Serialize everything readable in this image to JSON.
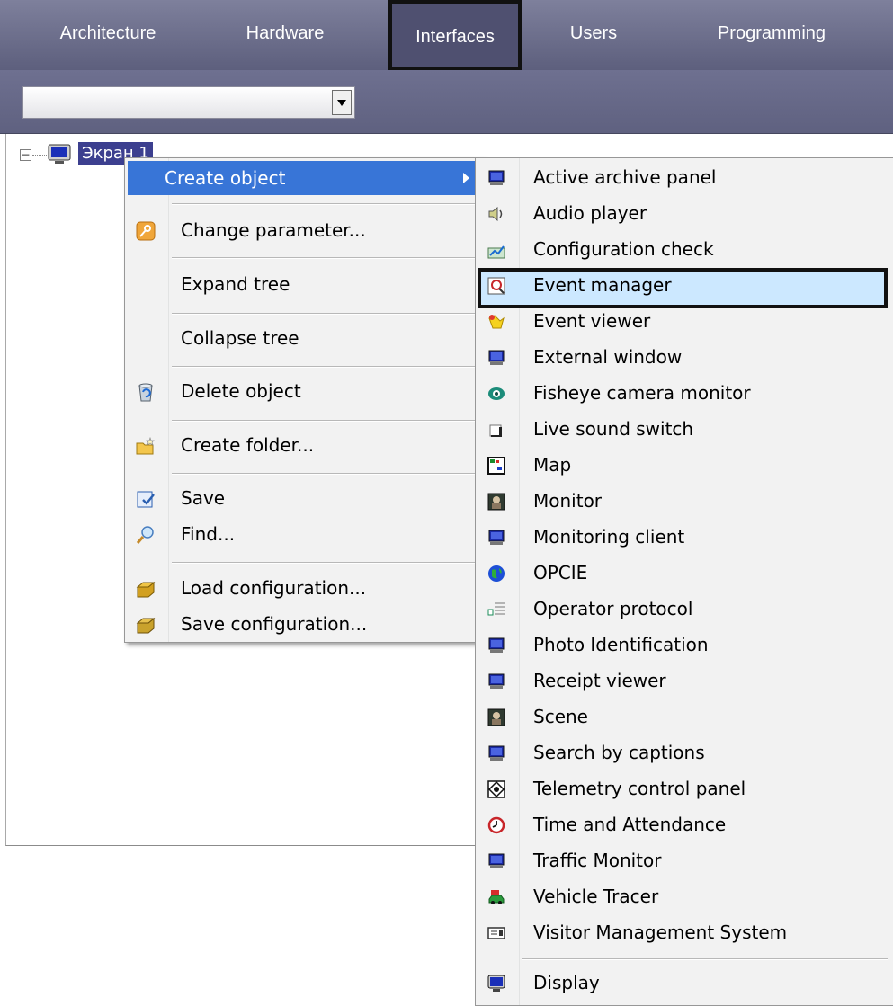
{
  "tabs": [
    {
      "label": "Architecture",
      "active": false
    },
    {
      "label": "Hardware",
      "active": false
    },
    {
      "label": "Interfaces",
      "active": true
    },
    {
      "label": "Users",
      "active": false
    },
    {
      "label": "Programming",
      "active": false
    }
  ],
  "dropdown": {
    "value": ""
  },
  "tree": {
    "root_label": "Экран 1"
  },
  "context_menu": {
    "items": [
      {
        "label": "Create object",
        "icon": "none",
        "has_submenu": true,
        "highlighted": true
      },
      {
        "label": "Change parameter...",
        "icon": "key-icon"
      },
      {
        "label": "Expand tree",
        "icon": "none"
      },
      {
        "label": "Collapse tree",
        "icon": "none"
      },
      {
        "label": "Delete object",
        "icon": "recycle-bin-icon"
      },
      {
        "label": "Create folder...",
        "icon": "new-folder-icon"
      },
      {
        "label": "Save",
        "icon": "save-icon"
      },
      {
        "label": "Find...",
        "icon": "magnifier-icon"
      },
      {
        "label": "Load configuration...",
        "icon": "load-config-icon"
      },
      {
        "label": "Save configuration...",
        "icon": "save-config-icon"
      }
    ]
  },
  "submenu": {
    "items": [
      {
        "label": "Active archive panel",
        "icon": "monitor-icon"
      },
      {
        "label": "Audio player",
        "icon": "speaker-icon"
      },
      {
        "label": "Configuration check",
        "icon": "chart-check-icon"
      },
      {
        "label": "Event manager",
        "icon": "event-manager-icon",
        "highlighted": true
      },
      {
        "label": "Event viewer",
        "icon": "event-viewer-icon"
      },
      {
        "label": "External window",
        "icon": "monitor-icon"
      },
      {
        "label": "Fisheye camera monitor",
        "icon": "fisheye-icon"
      },
      {
        "label": "Live sound switch",
        "icon": "window-icon"
      },
      {
        "label": "Map",
        "icon": "map-icon"
      },
      {
        "label": "Monitor",
        "icon": "camera-monitor-icon"
      },
      {
        "label": "Monitoring client",
        "icon": "monitor-icon"
      },
      {
        "label": "OPCIE",
        "icon": "globe-icon"
      },
      {
        "label": "Operator protocol",
        "icon": "protocol-list-icon"
      },
      {
        "label": "Photo Identification",
        "icon": "monitor-icon"
      },
      {
        "label": "Receipt viewer",
        "icon": "monitor-icon"
      },
      {
        "label": "Scene",
        "icon": "camera-monitor-icon"
      },
      {
        "label": "Search by captions",
        "icon": "monitor-icon"
      },
      {
        "label": "Telemetry control panel",
        "icon": "telemetry-icon"
      },
      {
        "label": "Time and Attendance",
        "icon": "clock-icon"
      },
      {
        "label": "Traffic Monitor",
        "icon": "monitor-icon"
      },
      {
        "label": "Vehicle Tracer",
        "icon": "vehicle-icon"
      },
      {
        "label": "Visitor Management System",
        "icon": "id-card-icon"
      },
      {
        "label": "Display",
        "icon": "display-icon"
      }
    ]
  },
  "colors": {
    "tabbar": "#6a6c8b",
    "menu_highlight": "#3875d7",
    "submenu_highlight": "#cce8ff",
    "tree_selection": "#3c3f8f"
  }
}
